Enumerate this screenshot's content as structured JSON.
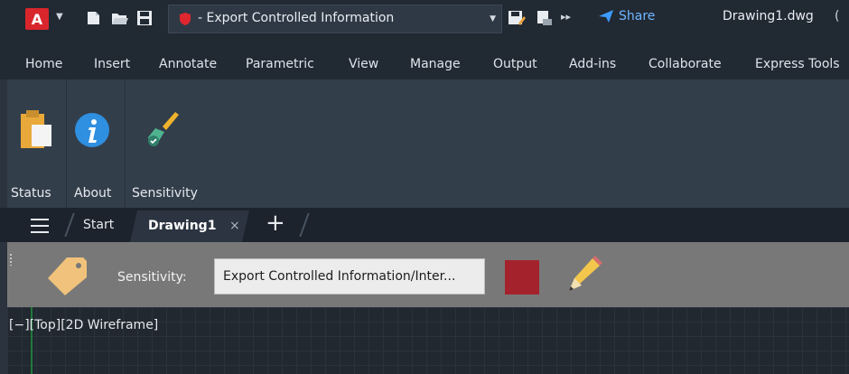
{
  "titlebar": {
    "app_letter": "A",
    "workspace": "- Export Controlled Information",
    "share_label": "Share",
    "filename": "Drawing1.dwg",
    "more_glyph": "("
  },
  "ribbon_tabs": [
    "Home",
    "Insert",
    "Annotate",
    "Parametric",
    "View",
    "Manage",
    "Output",
    "Add-ins",
    "Collaborate",
    "Express Tools"
  ],
  "ribbon": {
    "status_label": "Status",
    "about_label": "About",
    "sensitivity_label": "Sensitivity"
  },
  "file_tabs": {
    "start_label": "Start",
    "active_label": "Drawing1",
    "close_glyph": "×",
    "new_glyph": "+"
  },
  "sensitivity_bar": {
    "label": "Sensitivity:",
    "value": "Export Controlled Information/Inter...",
    "color": "#a4222b"
  },
  "viewport": {
    "label": "[−][Top][2D Wireframe]"
  },
  "icons": {
    "tag": "tag-icon",
    "pencil": "pencil-icon",
    "status": "clipboard-icon",
    "about": "info-icon",
    "sensitivity": "brush-icon"
  }
}
